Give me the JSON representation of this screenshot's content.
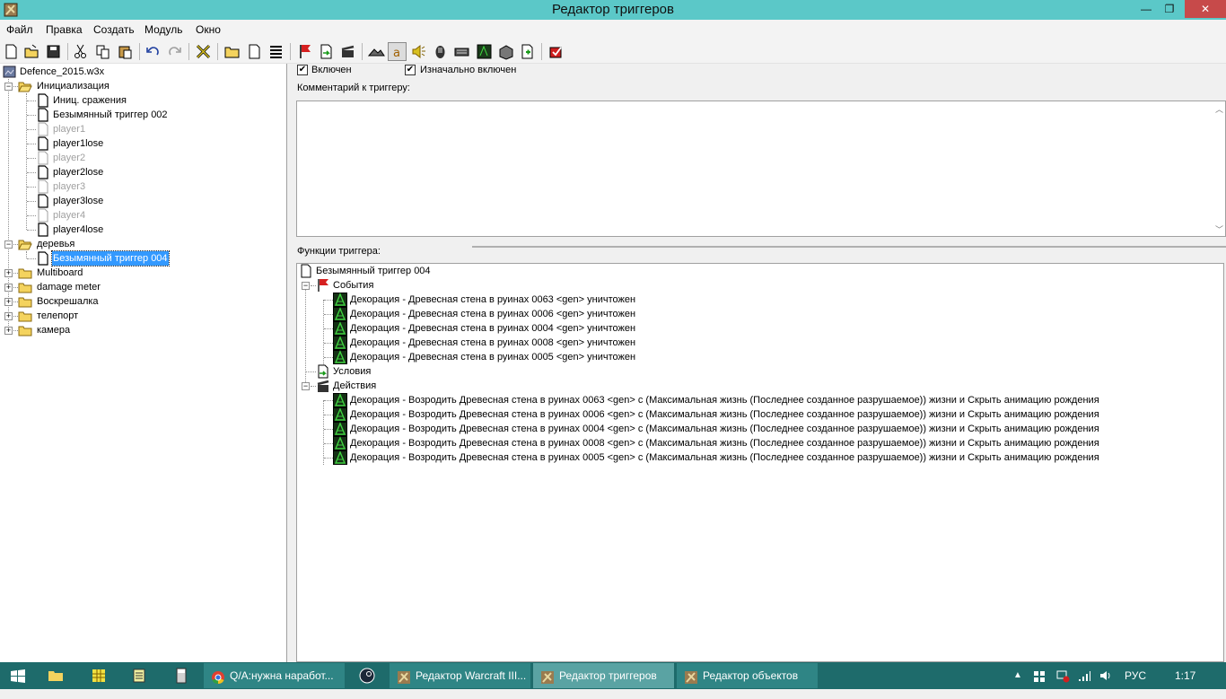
{
  "window": {
    "title": "Редактор триггеров",
    "controls": {
      "minimize": "—",
      "maximize": "❐",
      "close": "✕"
    }
  },
  "menu": [
    "Файл",
    "Правка",
    "Создать",
    "Модуль",
    "Окно"
  ],
  "toolbar_icons": [
    "new-file-icon",
    "open-folder-icon",
    "save-icon",
    "cut-icon",
    "copy-icon",
    "paste-icon",
    "undo-icon",
    "redo-icon",
    "delete-x-icon",
    "new-category-icon",
    "new-trigger-icon",
    "new-comment-icon",
    "terrain-editor-icon",
    "unit-editor-icon",
    "ability-editor-icon",
    "sound-editor-icon",
    "object-editor-icon",
    "campaign-editor-icon",
    "ai-editor-icon",
    "object-manager-icon",
    "import-manager-icon",
    "test-map-icon"
  ],
  "tree": {
    "map_file": "Defence_2015.w3x",
    "items": [
      {
        "label": "Инициализация",
        "type": "folder",
        "level": 1,
        "expanded": true
      },
      {
        "label": "Иниц. сражения",
        "type": "trigger",
        "level": 2
      },
      {
        "label": "Безымянный триггер 002",
        "type": "trigger",
        "level": 2
      },
      {
        "label": "player1",
        "type": "trigger",
        "level": 2,
        "disabled": true
      },
      {
        "label": "player1lose",
        "type": "trigger",
        "level": 2
      },
      {
        "label": "player2",
        "type": "trigger",
        "level": 2,
        "disabled": true
      },
      {
        "label": "player2lose",
        "type": "trigger",
        "level": 2
      },
      {
        "label": "player3",
        "type": "trigger",
        "level": 2,
        "disabled": true
      },
      {
        "label": "player3lose",
        "type": "trigger",
        "level": 2
      },
      {
        "label": "player4",
        "type": "trigger",
        "level": 2,
        "disabled": true
      },
      {
        "label": "player4lose",
        "type": "trigger",
        "level": 2
      },
      {
        "label": "деревья",
        "type": "folder",
        "level": 1,
        "expanded": true
      },
      {
        "label": "Безымянный триггер 004",
        "type": "trigger",
        "level": 2,
        "selected": true
      },
      {
        "label": "Multiboard",
        "type": "folder",
        "level": 1
      },
      {
        "label": "damage meter",
        "type": "folder",
        "level": 1
      },
      {
        "label": "Воскрешалка",
        "type": "folder",
        "level": 1
      },
      {
        "label": "телепорт",
        "type": "folder",
        "level": 1
      },
      {
        "label": "камера",
        "type": "folder",
        "level": 1
      }
    ]
  },
  "trigger": {
    "enabled_label": "Включен",
    "enabled": true,
    "initially_on_label": "Изначально включен",
    "initially_on": true,
    "comment_label": "Комментарий к триггеру:",
    "comment": "",
    "functions_label": "Функции триггера:",
    "name": "Безымянный триггер 004",
    "events_label": "События",
    "events": [
      "Декорация - Древесная стена в руинах 0063 <gen> уничтожен",
      "Декорация - Древесная стена в руинах 0006 <gen> уничтожен",
      "Декорация - Древесная стена в руинах 0004 <gen> уничтожен",
      "Декорация - Древесная стена в руинах 0008 <gen> уничтожен",
      "Декорация - Древесная стена в руинах 0005 <gen> уничтожен"
    ],
    "conditions_label": "Условия",
    "actions_label": "Действия",
    "actions": [
      "Декорация - Возродить Древесная стена в руинах 0063 <gen> с (Максимальная жизнь (Последнее созданное разрушаемое)) жизни и Скрыть анимацию рождения",
      "Декорация - Возродить Древесная стена в руинах 0006 <gen> с (Максимальная жизнь (Последнее созданное разрушаемое)) жизни и Скрыть анимацию рождения",
      "Декорация - Возродить Древесная стена в руинах 0004 <gen> с (Максимальная жизнь (Последнее созданное разрушаемое)) жизни и Скрыть анимацию рождения",
      "Декорация - Возродить Древесная стена в руинах 0008 <gen> с (Максимальная жизнь (Последнее созданное разрушаемое)) жизни и Скрыть анимацию рождения",
      "Декорация - Возродить Древесная стена в руинах 0005 <gen> с (Максимальная жизнь (Последнее созданное разрушаемое)) жизни и Скрыть анимацию рождения"
    ]
  },
  "taskbar": {
    "items": [
      {
        "label": "Q/A:нужна наработ...",
        "icon": "chrome-icon"
      },
      {
        "label": "Редактор Warcraft III...",
        "icon": "worldedit-icon"
      },
      {
        "label": "Редактор триггеров",
        "icon": "worldedit-icon",
        "active": true
      },
      {
        "label": "Редактор объектов",
        "icon": "worldedit-icon"
      }
    ],
    "language": "РУС",
    "time": "1:17"
  },
  "colors": {
    "titlebar": "#5bc8c8",
    "taskbar": "#1e6b6b",
    "selection": "#3399ff",
    "close_button": "#c74a4a"
  }
}
